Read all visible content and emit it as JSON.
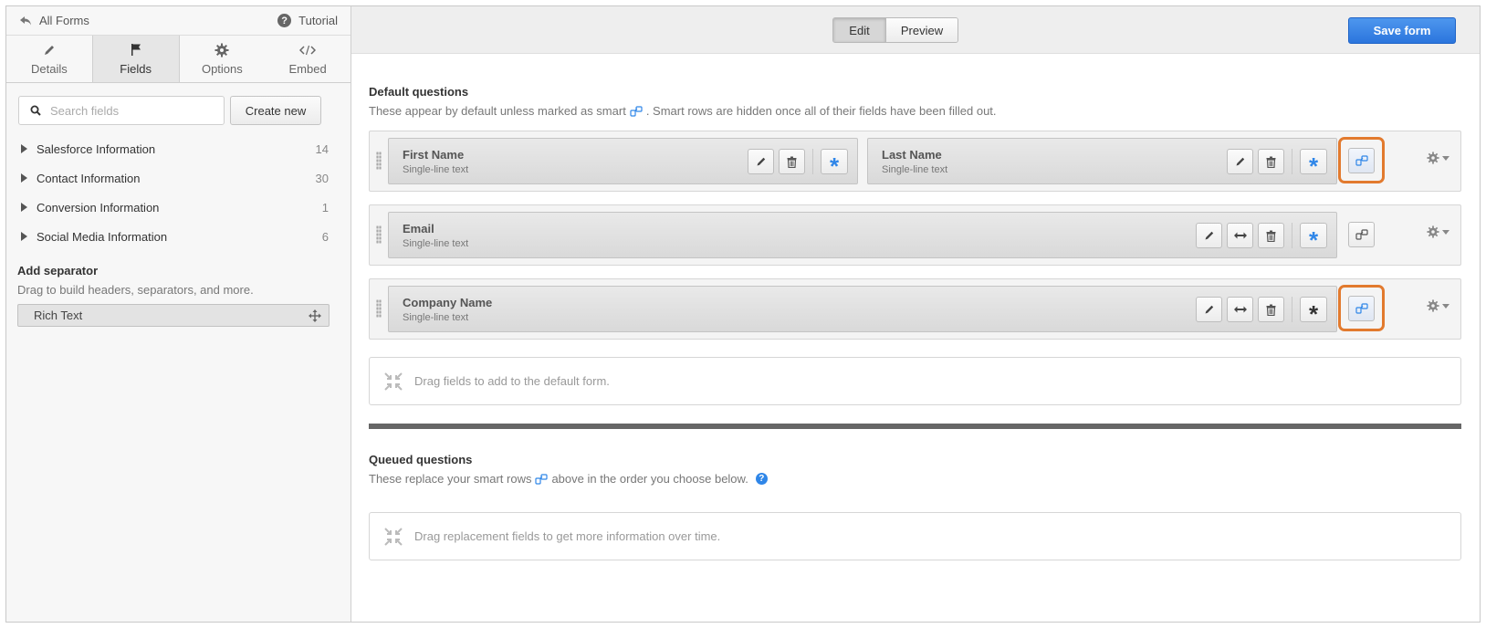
{
  "sidebar": {
    "back_label": "All Forms",
    "tutorial_label": "Tutorial",
    "tabs": [
      {
        "label": "Details",
        "icon": "pencil-icon"
      },
      {
        "label": "Fields",
        "icon": "flag-icon"
      },
      {
        "label": "Options",
        "icon": "gear-icon"
      },
      {
        "label": "Embed",
        "icon": "code-icon"
      }
    ],
    "active_tab": "Fields",
    "search_placeholder": "Search fields",
    "create_label": "Create new",
    "categories": [
      {
        "label": "Salesforce Information",
        "count": "14"
      },
      {
        "label": "Contact Information",
        "count": "30"
      },
      {
        "label": "Conversion Information",
        "count": "1"
      },
      {
        "label": "Social Media Information",
        "count": "6"
      }
    ],
    "separator_title": "Add separator",
    "separator_desc": "Drag to build headers, separators, and more.",
    "rich_text_label": "Rich Text"
  },
  "toolbar": {
    "edit_label": "Edit",
    "preview_label": "Preview",
    "save_label": "Save form",
    "save_color": "#2f7ce0"
  },
  "default_section": {
    "title": "Default questions",
    "desc_before": "These appear by default unless marked as smart",
    "desc_after": ". Smart rows are hidden once all of their fields have been filled out.",
    "rows": [
      {
        "fields": [
          {
            "name": "First Name",
            "type": "Single-line text"
          },
          {
            "name": "Last Name",
            "type": "Single-line text"
          }
        ]
      },
      {
        "fields": [
          {
            "name": "Email",
            "type": "Single-line text"
          }
        ]
      },
      {
        "fields": [
          {
            "name": "Company Name",
            "type": "Single-line text"
          }
        ]
      }
    ],
    "dropzone_text": "Drag fields to add to the default form."
  },
  "queued_section": {
    "title": "Queued questions",
    "desc_before": "These replace your smart rows",
    "desc_after": "above in the order you choose below.",
    "dropzone_text": "Drag replacement fields to get more information over time."
  },
  "colors": {
    "required_active": "#2f86e8",
    "highlight": "#e27a2e"
  }
}
